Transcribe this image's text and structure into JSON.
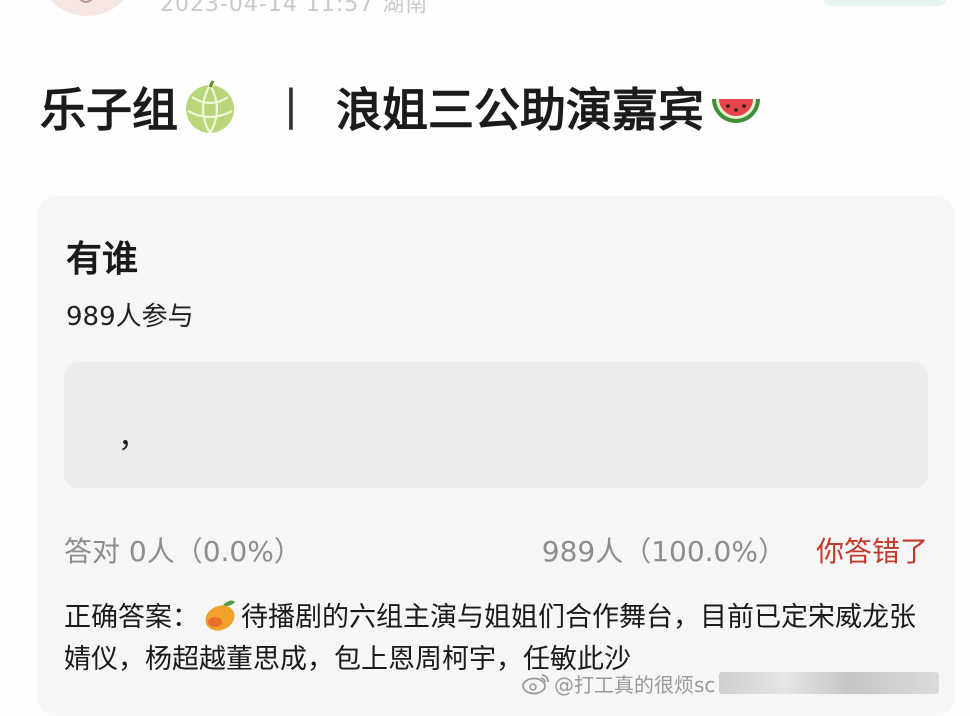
{
  "header": {
    "meta_text": "2023-04-14 11:57 湖南"
  },
  "post": {
    "title_left": "乐子组",
    "separator": "丨",
    "title_right": "浪姐三公助演嘉宾",
    "title_left_icon": "melon-icon",
    "title_right_icon": "watermelon-icon"
  },
  "question": {
    "title": "有谁",
    "participants": "989人参与",
    "answer_value": "，",
    "correct_count": "答对  0人（0.0%）",
    "wrong_count": "989人（100.0%）",
    "result_label": "你答错了",
    "correct_answer_label": "正确答案：",
    "correct_answer_icon": "mango-icon",
    "correct_answer_text": "待播剧的六组主演与姐姐们合作舞台，目前已定宋威龙张婧仪，杨超越董思成，包上恩周柯宇，任敏此沙"
  },
  "watermark": {
    "text": "@打工真的很烦sc",
    "icon": "weibo-icon"
  },
  "colors": {
    "wrong": "#c0392b",
    "muted": "#8d8d8d",
    "card": "#f6f6f6"
  }
}
